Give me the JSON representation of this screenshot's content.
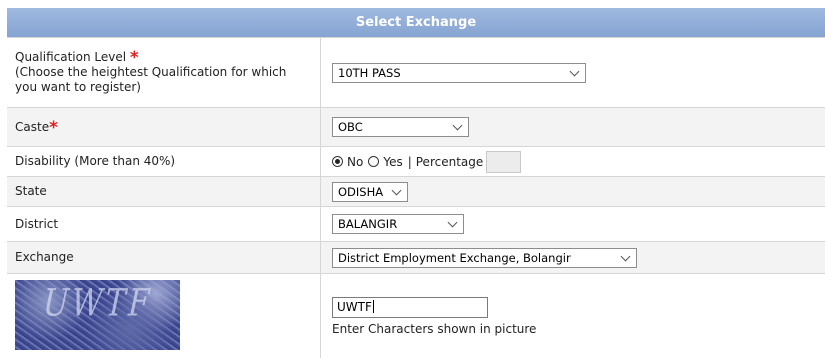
{
  "header": {
    "title": "Select Exchange"
  },
  "qualification": {
    "label": "Qualification Level",
    "hint": "(Choose the heightest Qualification for which you want to register)",
    "required_mark": "*",
    "value": "10TH PASS"
  },
  "caste": {
    "label": "Caste",
    "required_mark": "*",
    "value": "OBC"
  },
  "disability": {
    "label": "Disability (More than 40%)",
    "options": [
      "No",
      "Yes"
    ],
    "selected": "No",
    "separator": "|",
    "percentage_label": "Percentage"
  },
  "state": {
    "label": "State",
    "value": "ODISHA"
  },
  "district": {
    "label": "District",
    "value": "BALANGIR"
  },
  "exchange": {
    "label": "Exchange",
    "value": "District Employment Exchange, Bolangir"
  },
  "captcha": {
    "image_text": "UWTF",
    "input_value": "UWTF",
    "help_text": "Enter Characters shown in picture"
  },
  "colors": {
    "header_bg": "#8ea9d6",
    "required": "#e02020",
    "alt_row": "#f3f3f3"
  },
  "icons": {
    "dropdown": "chevron-down-icon"
  }
}
